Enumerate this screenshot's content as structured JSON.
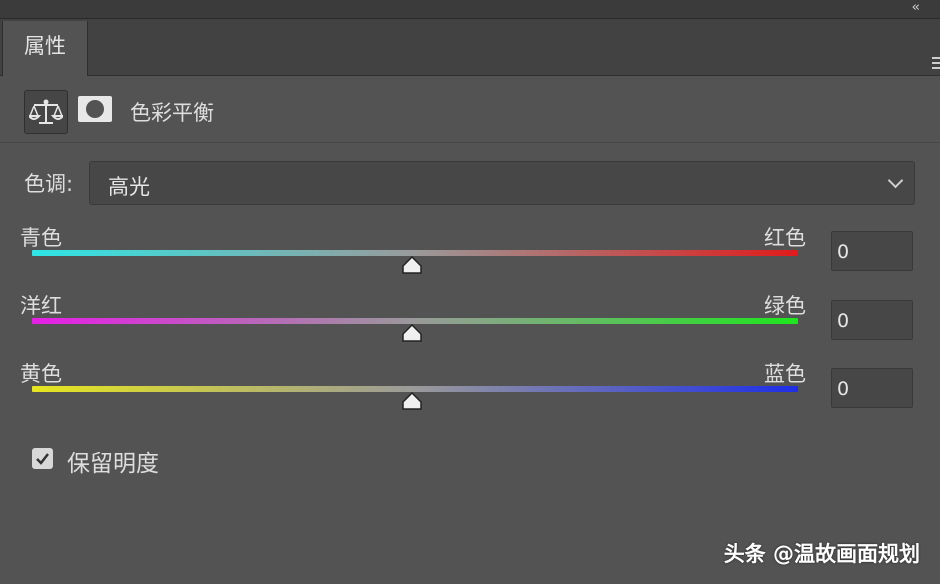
{
  "panel": {
    "tab_label": "属性",
    "collapse_icon": "double-chevron-left-icon",
    "menu_icon": "hamburger-menu-icon"
  },
  "adjustment": {
    "icon": "balance-scale-icon",
    "mask_icon": "layer-mask-icon",
    "title": "色彩平衡"
  },
  "tone": {
    "label": "色调:",
    "selected": "高光"
  },
  "sliders": [
    {
      "left_label": "青色",
      "right_label": "红色",
      "value": "0",
      "left_color": "#2ee6e6",
      "right_color": "#e01b1b"
    },
    {
      "left_label": "洋红",
      "right_label": "绿色",
      "value": "0",
      "left_color": "#e61ee6",
      "right_color": "#1ee61e"
    },
    {
      "left_label": "黄色",
      "right_label": "蓝色",
      "value": "0",
      "left_color": "#e6e61e",
      "right_color": "#1e2ee6"
    }
  ],
  "preserve_luminosity": {
    "label": "保留明度",
    "checked": true
  },
  "watermark": "头条 @温故画面规划"
}
